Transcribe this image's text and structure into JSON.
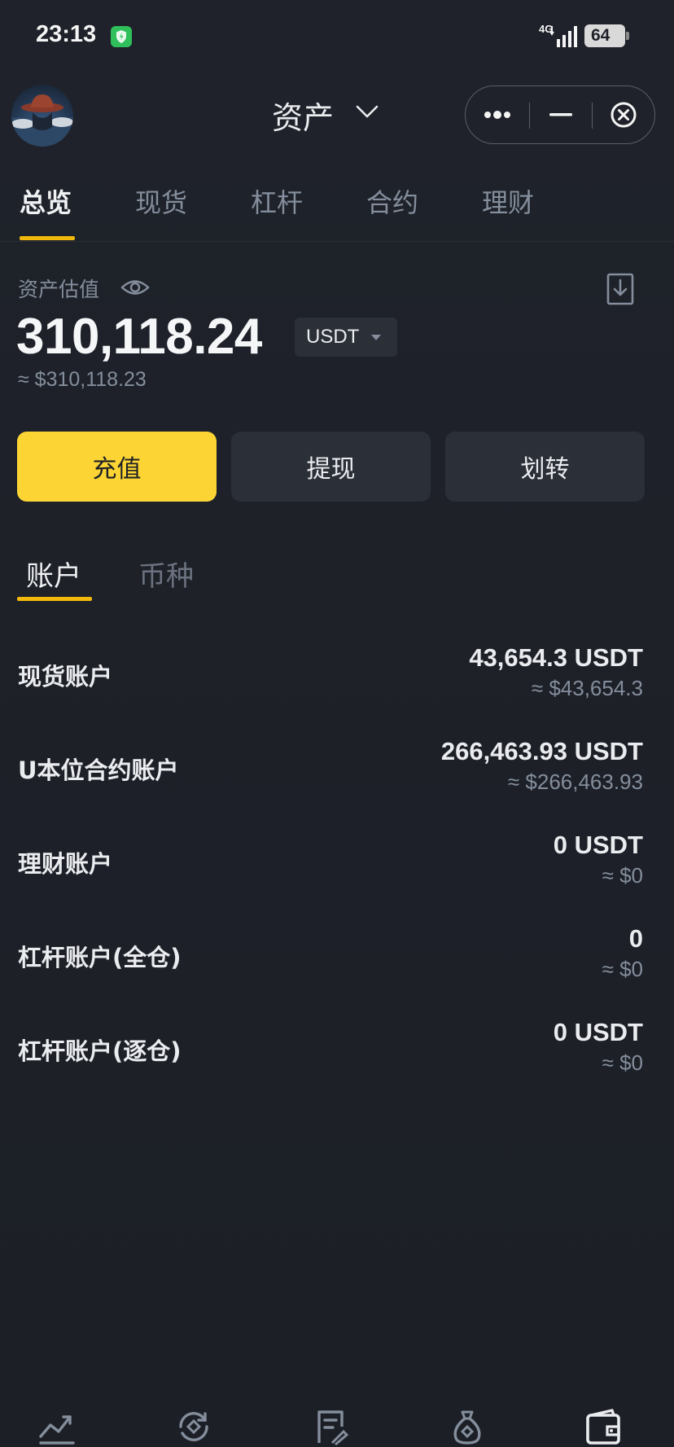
{
  "status_bar": {
    "time": "23:13",
    "network": "4G",
    "battery": "64"
  },
  "header": {
    "title": "资产",
    "icons": [
      "avatar",
      "chevron-down-icon",
      "more-icon",
      "minimize-icon",
      "close-icon"
    ]
  },
  "top_tabs": [
    {
      "label": "总览",
      "active": true
    },
    {
      "label": "现货",
      "active": false
    },
    {
      "label": "杠杆",
      "active": false
    },
    {
      "label": "合约",
      "active": false
    },
    {
      "label": "理财",
      "active": false
    }
  ],
  "overview": {
    "estimate_label": "资产估值",
    "total_value": "310,118.24",
    "unit": "USDT",
    "usd_approx": "≈ $310,118.23"
  },
  "actions": {
    "deposit": "充值",
    "withdraw": "提现",
    "transfer": "划转"
  },
  "sub_tabs": [
    {
      "label": "账户",
      "active": true
    },
    {
      "label": "币种",
      "active": false
    }
  ],
  "accounts": [
    {
      "name": "现货账户",
      "amount": "43,654.3 USDT",
      "usd": "≈ $43,654.3"
    },
    {
      "name": "U本位合约账户",
      "amount": "266,463.93 USDT",
      "usd": "≈ $266,463.93"
    },
    {
      "name": "理财账户",
      "amount": "0 USDT",
      "usd": "≈ $0"
    },
    {
      "name": "杠杆账户(全仓)",
      "amount": "0",
      "usd": "≈ $0"
    },
    {
      "name": "杠杆账户(逐仓)",
      "amount": "0 USDT",
      "usd": "≈ $0"
    }
  ],
  "bottom_nav": [
    "markets-icon",
    "trade-icon",
    "orders-icon",
    "earn-icon",
    "wallet-icon"
  ],
  "colors": {
    "background": "#1e2129",
    "accent": "#fcd535",
    "tab_underline": "#f0b90b",
    "muted_text": "#848e9c",
    "button_secondary": "#2b2f37"
  }
}
